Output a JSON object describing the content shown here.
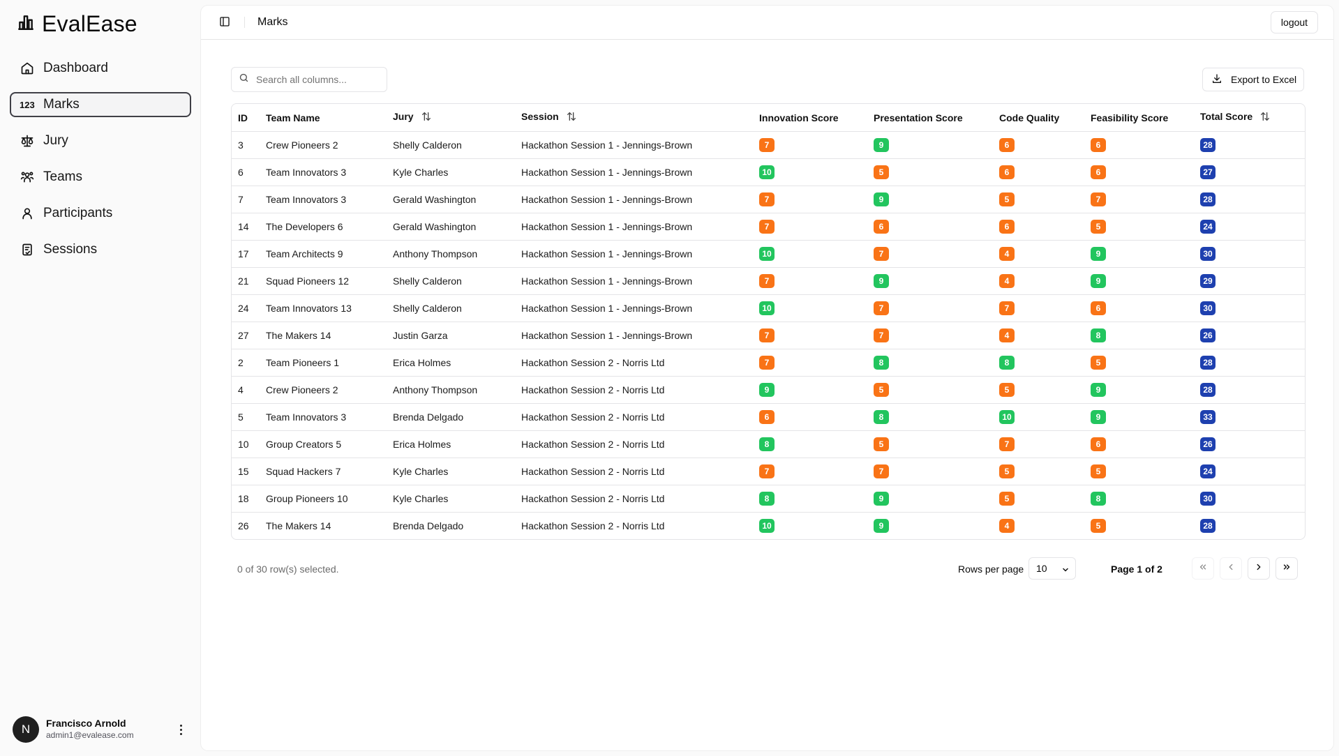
{
  "app": {
    "name": "EvalEase"
  },
  "sidebar": {
    "items": [
      {
        "label": "Dashboard",
        "icon": "home-icon",
        "active": false
      },
      {
        "label": "Marks",
        "icon": "numbers-icon",
        "active": true
      },
      {
        "label": "Jury",
        "icon": "scale-icon",
        "active": false
      },
      {
        "label": "Teams",
        "icon": "users-icon",
        "active": false
      },
      {
        "label": "Participants",
        "icon": "user-icon",
        "active": false
      },
      {
        "label": "Sessions",
        "icon": "clipboard-check-icon",
        "active": false
      }
    ],
    "user": {
      "initial": "N",
      "name": "Francisco Arnold",
      "email": "admin1@evalease.com"
    }
  },
  "header": {
    "title": "Marks",
    "logout_label": "logout"
  },
  "toolbar": {
    "search_placeholder": "Search all columns...",
    "export_label": "Export to Excel"
  },
  "table": {
    "columns": [
      "ID",
      "Team Name",
      "Jury",
      "Session",
      "Innovation Score",
      "Presentation Score",
      "Code Quality",
      "Feasibility Score",
      "Total Score"
    ],
    "sortable": [
      "Jury",
      "Session",
      "Total Score"
    ],
    "rows": [
      {
        "id": "3",
        "team": "Crew Pioneers 2",
        "jury": "Shelly Calderon",
        "session": "Hackathon Session 1 - Jennings-Brown",
        "innovation": "7",
        "presentation": "9",
        "code": "6",
        "feasibility": "6",
        "total": "28"
      },
      {
        "id": "6",
        "team": "Team Innovators 3",
        "jury": "Kyle Charles",
        "session": "Hackathon Session 1 - Jennings-Brown",
        "innovation": "10",
        "presentation": "5",
        "code": "6",
        "feasibility": "6",
        "total": "27"
      },
      {
        "id": "7",
        "team": "Team Innovators 3",
        "jury": "Gerald Washington",
        "session": "Hackathon Session 1 - Jennings-Brown",
        "innovation": "7",
        "presentation": "9",
        "code": "5",
        "feasibility": "7",
        "total": "28"
      },
      {
        "id": "14",
        "team": "The Developers 6",
        "jury": "Gerald Washington",
        "session": "Hackathon Session 1 - Jennings-Brown",
        "innovation": "7",
        "presentation": "6",
        "code": "6",
        "feasibility": "5",
        "total": "24"
      },
      {
        "id": "17",
        "team": "Team Architects 9",
        "jury": "Anthony Thompson",
        "session": "Hackathon Session 1 - Jennings-Brown",
        "innovation": "10",
        "presentation": "7",
        "code": "4",
        "feasibility": "9",
        "total": "30"
      },
      {
        "id": "21",
        "team": "Squad Pioneers 12",
        "jury": "Shelly Calderon",
        "session": "Hackathon Session 1 - Jennings-Brown",
        "innovation": "7",
        "presentation": "9",
        "code": "4",
        "feasibility": "9",
        "total": "29"
      },
      {
        "id": "24",
        "team": "Team Innovators 13",
        "jury": "Shelly Calderon",
        "session": "Hackathon Session 1 - Jennings-Brown",
        "innovation": "10",
        "presentation": "7",
        "code": "7",
        "feasibility": "6",
        "total": "30"
      },
      {
        "id": "27",
        "team": "The Makers 14",
        "jury": "Justin Garza",
        "session": "Hackathon Session 1 - Jennings-Brown",
        "innovation": "7",
        "presentation": "7",
        "code": "4",
        "feasibility": "8",
        "total": "26"
      },
      {
        "id": "2",
        "team": "Team Pioneers 1",
        "jury": "Erica Holmes",
        "session": "Hackathon Session 2 - Norris Ltd",
        "innovation": "7",
        "presentation": "8",
        "code": "8",
        "feasibility": "5",
        "total": "28"
      },
      {
        "id": "4",
        "team": "Crew Pioneers 2",
        "jury": "Anthony Thompson",
        "session": "Hackathon Session 2 - Norris Ltd",
        "innovation": "9",
        "presentation": "5",
        "code": "5",
        "feasibility": "9",
        "total": "28"
      },
      {
        "id": "5",
        "team": "Team Innovators 3",
        "jury": "Brenda Delgado",
        "session": "Hackathon Session 2 - Norris Ltd",
        "innovation": "6",
        "presentation": "8",
        "code": "10",
        "feasibility": "9",
        "total": "33"
      },
      {
        "id": "10",
        "team": "Group Creators 5",
        "jury": "Erica Holmes",
        "session": "Hackathon Session 2 - Norris Ltd",
        "innovation": "8",
        "presentation": "5",
        "code": "7",
        "feasibility": "6",
        "total": "26"
      },
      {
        "id": "15",
        "team": "Squad Hackers 7",
        "jury": "Kyle Charles",
        "session": "Hackathon Session 2 - Norris Ltd",
        "innovation": "7",
        "presentation": "7",
        "code": "5",
        "feasibility": "5",
        "total": "24"
      },
      {
        "id": "18",
        "team": "Group Pioneers 10",
        "jury": "Kyle Charles",
        "session": "Hackathon Session 2 - Norris Ltd",
        "innovation": "8",
        "presentation": "9",
        "code": "5",
        "feasibility": "8",
        "total": "30"
      },
      {
        "id": "26",
        "team": "The Makers 14",
        "jury": "Brenda Delgado",
        "session": "Hackathon Session 2 - Norris Ltd",
        "innovation": "10",
        "presentation": "9",
        "code": "4",
        "feasibility": "5",
        "total": "28"
      }
    ]
  },
  "footer": {
    "selection_text": "0 of 30 row(s) selected.",
    "rows_per_page_label": "Rows per page",
    "rows_per_page_value": "10",
    "page_info": "Page 1 of 2"
  },
  "colors": {
    "high": "#22c55e",
    "mid": "#f97316",
    "total": "#1e40af"
  }
}
